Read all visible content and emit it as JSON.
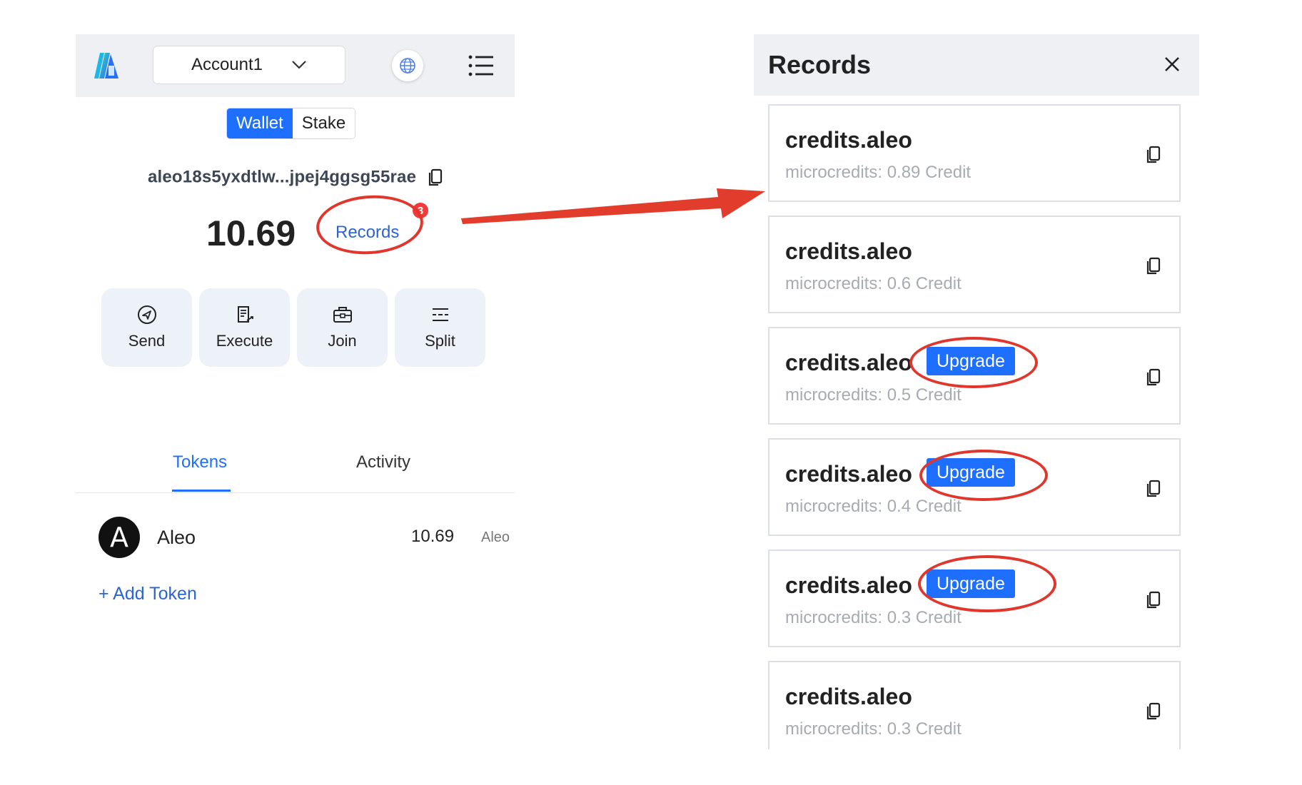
{
  "wallet": {
    "account_name": "Account1",
    "tabs": [
      "Wallet",
      "Stake"
    ],
    "address": "aleo18s5yxdtlw...jpej4ggsg55rae",
    "balance": "10.69",
    "records_label": "Records",
    "records_badge": "3",
    "actions": [
      {
        "label": "Send",
        "icon": "send-icon"
      },
      {
        "label": "Execute",
        "icon": "execute-icon"
      },
      {
        "label": "Join",
        "icon": "join-icon"
      },
      {
        "label": "Split",
        "icon": "split-icon"
      }
    ],
    "content_tabs": [
      "Tokens",
      "Activity"
    ],
    "token": {
      "avatar": "A",
      "name": "Aleo",
      "amount": "10.69",
      "unit": "Aleo"
    },
    "add_token_label": "+ Add Token"
  },
  "records_panel": {
    "title": "Records",
    "items": [
      {
        "title": "credits.aleo",
        "sub": "microcredits: 0.89 Credit",
        "upgrade": ""
      },
      {
        "title": "credits.aleo",
        "sub": "microcredits: 0.6 Credit",
        "upgrade": ""
      },
      {
        "title": "credits.aleo",
        "sub": "microcredits: 0.5 Credit",
        "upgrade": "Upgrade"
      },
      {
        "title": "credits.aleo",
        "sub": "microcredits: 0.4 Credit",
        "upgrade": "Upgrade"
      },
      {
        "title": "credits.aleo",
        "sub": "microcredits: 0.3 Credit",
        "upgrade": "Upgrade"
      },
      {
        "title": "credits.aleo",
        "sub": "microcredits: 0.3 Credit",
        "upgrade": ""
      }
    ]
  },
  "colors": {
    "accent": "#1f6fff",
    "annotation": "#e0362c",
    "badge": "#f23a3a"
  }
}
